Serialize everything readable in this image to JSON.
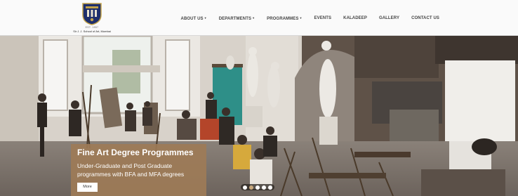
{
  "header": {
    "logo_year": "EST. 1857",
    "institution_name": "Sir J. J. School of Art, Mumbai",
    "brand_color": "#1e2f6b",
    "logo_accent_color": "#c2a24a"
  },
  "nav": {
    "items": [
      {
        "label": "About Us",
        "dropdown": true
      },
      {
        "label": "Departments",
        "dropdown": true
      },
      {
        "label": "Programmes",
        "dropdown": true
      },
      {
        "label": "Events",
        "dropdown": false
      },
      {
        "label": "Kaladeep",
        "dropdown": false
      },
      {
        "label": "Gallery",
        "dropdown": false
      },
      {
        "label": "Contact Us",
        "dropdown": false
      }
    ],
    "caret_icon": "chevron-down-icon"
  },
  "hero": {
    "image_icon": "photo-icon",
    "caption": {
      "title": "Fine Art Degree Programmes",
      "text": "Under-Graduate and Post Graduate programmes with BFA and MFA degrees",
      "button_label": "More",
      "panel_color": "#9f7b56"
    },
    "slider": {
      "slide_count": 5,
      "active_index": 1
    }
  }
}
